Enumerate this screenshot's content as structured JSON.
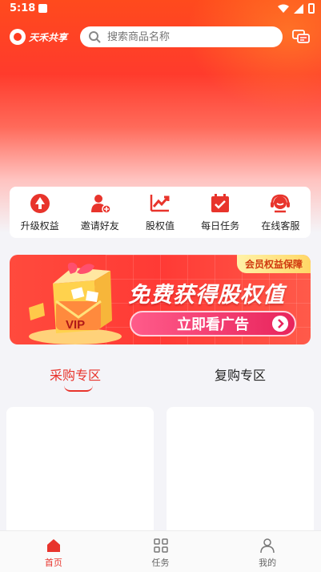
{
  "status_bar": {
    "time": "5:18"
  },
  "header": {
    "logo_text": "天禾共享",
    "search_placeholder": "搜索商品名称"
  },
  "quick_actions": [
    {
      "label": "升级权益",
      "icon": "upgrade-icon"
    },
    {
      "label": "邀请好友",
      "icon": "invite-friend-icon"
    },
    {
      "label": "股权值",
      "icon": "equity-chart-icon"
    },
    {
      "label": "每日任务",
      "icon": "daily-task-icon"
    },
    {
      "label": "在线客服",
      "icon": "customer-service-icon"
    }
  ],
  "banner": {
    "badge": "会员权益保障",
    "headline": "免费获得股权值",
    "cta": "立即看广告",
    "vip_text": "VIP"
  },
  "zone_tabs": {
    "active": "采购专区",
    "inactive": "复购专区"
  },
  "bottom_nav": [
    {
      "label": "首页",
      "icon": "home-icon",
      "active": true
    },
    {
      "label": "任务",
      "icon": "task-grid-icon",
      "active": false
    },
    {
      "label": "我的",
      "icon": "profile-icon",
      "active": false
    }
  ],
  "colors": {
    "brand_red": "#e8342c",
    "hero_orange": "#ff4a1d"
  }
}
